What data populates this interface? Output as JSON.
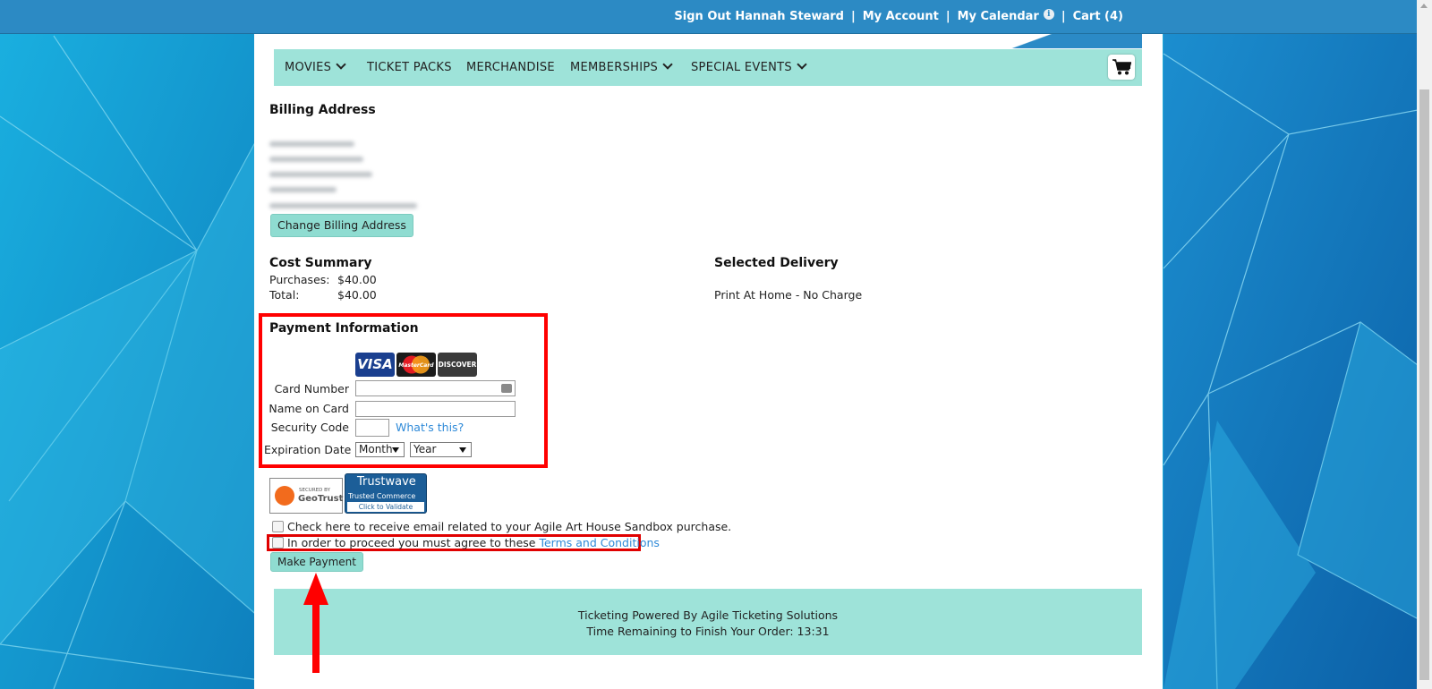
{
  "topnav": {
    "sign_out": "Sign Out Hannah Steward",
    "my_account": "My Account",
    "my_calendar": "My Calendar",
    "cart": "Cart (4)",
    "separator": "|"
  },
  "mainnav": {
    "items": [
      {
        "label": "MOVIES"
      },
      {
        "label": "TICKET PACKS"
      },
      {
        "label": "MERCHANDISE"
      },
      {
        "label": "MEMBERSHIPS"
      },
      {
        "label": "SPECIAL EVENTS"
      }
    ]
  },
  "billing": {
    "title": "Billing Address",
    "change_button": "Change Billing Address"
  },
  "cost_summary": {
    "title": "Cost Summary",
    "purchases_label": "Purchases:",
    "purchases_value": "$40.00",
    "total_label": "Total:",
    "total_value": "$40.00"
  },
  "delivery": {
    "title": "Selected Delivery",
    "value": "Print At Home - No Charge"
  },
  "payment": {
    "title": "Payment Information",
    "cards": [
      "VISA",
      "MasterCard",
      "DISCOVER"
    ],
    "card_number_label": "Card Number",
    "name_on_card_label": "Name on Card",
    "security_code_label": "Security Code",
    "whats_this": "What's this?",
    "expiration_label": "Expiration Date",
    "month_selected": "Month",
    "year_selected": "Year"
  },
  "trust": {
    "geotrust_top": "SECURED BY",
    "geotrust": "GeoTrust",
    "trustwave": "Trustwave",
    "trustwave_sub": "Trusted Commerce",
    "trustwave_click": "Click to Validate"
  },
  "checkout": {
    "email_opt_in": "Check here to receive email related to your Agile Art House Sandbox purchase.",
    "terms_prefix": "In order to proceed you must agree to these ",
    "terms_link": "Terms and Conditions",
    "make_payment": "Make Payment"
  },
  "footer": {
    "powered_by": "Ticketing Powered By Agile Ticketing Solutions",
    "time_remaining": "Time Remaining to Finish Your Order: 13:31"
  },
  "colors": {
    "topbar": "#2c8ac4",
    "nav_teal": "#9ee3d9",
    "annotation_red": "#ff0000",
    "link_blue": "#2f8ad8"
  }
}
